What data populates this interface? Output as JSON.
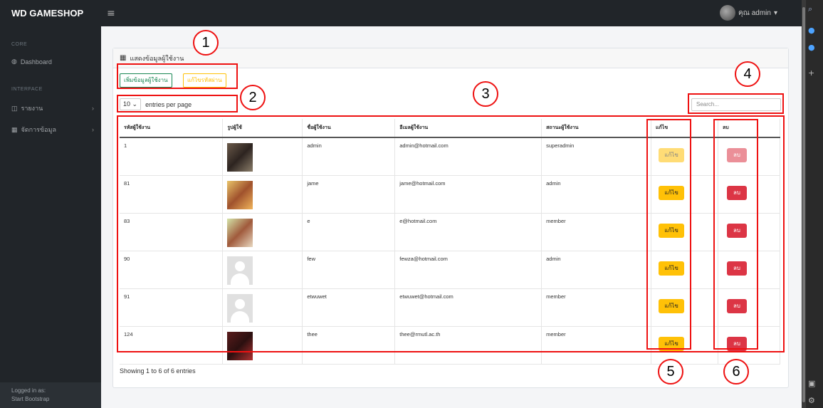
{
  "app": {
    "brand": "WD GAMESHOP",
    "menu_icon": "≡",
    "user_label": "คุณ admin",
    "caret": "▾"
  },
  "sidebar": {
    "core_heading": "CORE",
    "dashboard": "Dashboard",
    "interface_heading": "INTERFACE",
    "report": "รายงาน",
    "manage": "จัดการข้อมูล",
    "logged_in_as": "Logged in as:",
    "footer_name": "Start Bootstrap"
  },
  "card": {
    "title": "แสดงข้อมูลผู้ใช้งาน",
    "add_button": "เพิ่มข้อมูลผู้ใช้งาน",
    "password_button": "แก้ไขรหัสผ่าน",
    "entries_value": "10",
    "entries_label": "entries per page",
    "search_placeholder": "Search...",
    "showing_text": "Showing 1 to 6 of 6 entries"
  },
  "table": {
    "headers": [
      "รหัสผู้ใช้งาน",
      "รูปผู้ใช้",
      "ชื่อผู้ใช้งาน",
      "อีเมลผู้ใช้งาน",
      "สถานะผู้ใช้งาน",
      "แก้ไข",
      "ลบ"
    ],
    "edit_label": "แก้ไข",
    "delete_label": "ลบ",
    "rows": [
      {
        "id": "1",
        "name": "admin",
        "email": "admin@hotmail.com",
        "status": "superadmin"
      },
      {
        "id": "81",
        "name": "jame",
        "email": "jame@hotmail.com",
        "status": "admin"
      },
      {
        "id": "83",
        "name": "e",
        "email": "e@hotmail.com",
        "status": "member"
      },
      {
        "id": "90",
        "name": "few",
        "email": "fewza@hotmail.com",
        "status": "admin"
      },
      {
        "id": "91",
        "name": "etwuwet",
        "email": "etwuwet@hotmail.com",
        "status": "member"
      },
      {
        "id": "124",
        "name": "thee",
        "email": "thee@rmutl.ac.th",
        "status": "member"
      }
    ]
  },
  "annotations": {
    "n1": "1",
    "n2": "2",
    "n3": "3",
    "n4": "4",
    "n5": "5",
    "n6": "6"
  },
  "colors": {
    "highlight": "#ee1111",
    "edit": "#ffc107",
    "delete": "#dc3545",
    "add": "#198754"
  }
}
